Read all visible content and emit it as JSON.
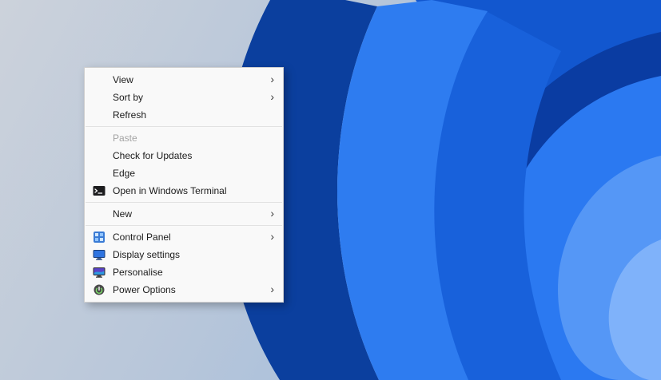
{
  "menu": {
    "submenu_arrow": "›",
    "items": [
      {
        "label": "View",
        "submenu": true
      },
      {
        "label": "Sort by",
        "submenu": true
      },
      {
        "label": "Refresh",
        "submenu": false
      },
      {
        "label": "Paste",
        "disabled": true
      },
      {
        "label": "Check for Updates"
      },
      {
        "label": "Edge"
      },
      {
        "label": "Open in Windows Terminal",
        "icon": "terminal-icon"
      },
      {
        "label": "New",
        "submenu": true
      },
      {
        "label": "Control Panel",
        "icon": "control-panel-icon",
        "submenu": true
      },
      {
        "label": "Display settings",
        "icon": "display-icon"
      },
      {
        "label": "Personalise",
        "icon": "personalise-icon"
      },
      {
        "label": "Power Options",
        "icon": "power-icon",
        "submenu": true
      }
    ]
  },
  "colors": {
    "menu_background": "#f9f9f9",
    "menu_border": "#cfcfcf",
    "menu_text": "#1b1b1b",
    "menu_disabled_text": "#a3a3a3",
    "wallpaper_background_light": "#bcc9da",
    "wallpaper_dark_blue": "#0b3f9e",
    "wallpaper_mid_blue": "#1861db",
    "wallpaper_bright_blue": "#2e7cf0",
    "wallpaper_light_blue": "#7fb2fa"
  }
}
